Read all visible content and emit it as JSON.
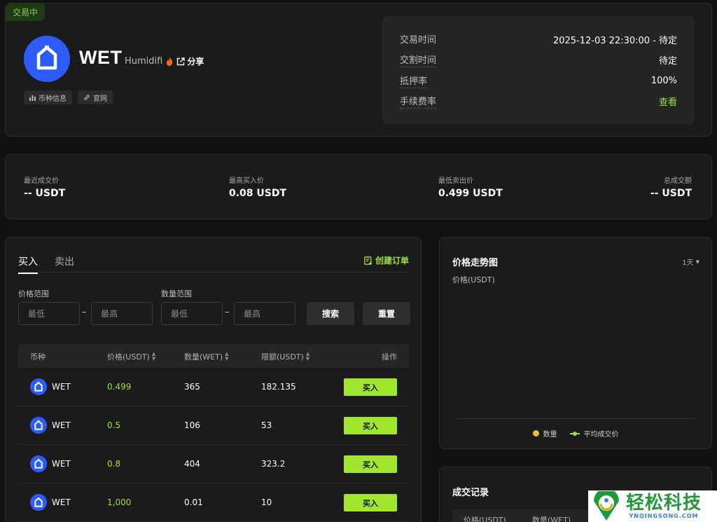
{
  "token": {
    "status": "交易中",
    "symbol": "WET",
    "project": "Humidifi",
    "share_label": "分享",
    "chips": [
      {
        "label": "币种信息"
      },
      {
        "label": "官网"
      }
    ],
    "logo_color": "#2e5bff"
  },
  "info": {
    "rows": [
      {
        "label": "交易时间",
        "value": "2025-12-03 22:30:00 - 待定"
      },
      {
        "label": "交割时间",
        "value": "待定"
      },
      {
        "label": "抵押率",
        "value": "100%"
      },
      {
        "label": "手续费率",
        "value": "查看"
      }
    ]
  },
  "stats": [
    {
      "label": "最近成交价",
      "value": "-- USDT"
    },
    {
      "label": "最高买入价",
      "value": "0.08 USDT"
    },
    {
      "label": "最低卖出价",
      "value": "0.499 USDT"
    },
    {
      "label": "总成交额",
      "value": "-- USDT"
    }
  ],
  "orderbook": {
    "tabs": [
      "买入",
      "卖出"
    ],
    "active_tab": "买入",
    "create_order_label": "创建订单",
    "price_range_label": "价格范围",
    "qty_range_label": "数量范围",
    "min_placeholder": "最低",
    "max_placeholder": "最高",
    "search_label": "搜索",
    "reset_label": "重置",
    "columns": [
      "币种",
      "价格(USDT)",
      "数量(WET)",
      "限额(USDT)",
      "操作"
    ],
    "rows": [
      {
        "coin": "WET",
        "price": "0.499",
        "qty": "365",
        "limit": "182.135",
        "action": "买入"
      },
      {
        "coin": "WET",
        "price": "0.5",
        "qty": "106",
        "limit": "53",
        "action": "买入"
      },
      {
        "coin": "WET",
        "price": "0.8",
        "qty": "404",
        "limit": "323.2",
        "action": "买入"
      },
      {
        "coin": "WET",
        "price": "1,000",
        "qty": "0.01",
        "limit": "10",
        "action": "买入"
      }
    ],
    "accent": "#9be23c"
  },
  "chart": {
    "title": "价格走势图",
    "range": "1天",
    "ylabel": "价格(USDT)",
    "legend": [
      "数量",
      "平均成交价"
    ]
  },
  "trades": {
    "title": "成交记录",
    "columns": [
      "价格(USDT)",
      "数量(WET)"
    ]
  },
  "watermark": {
    "main": "轻松科技",
    "sub": "YNQINGSONG.COM"
  }
}
